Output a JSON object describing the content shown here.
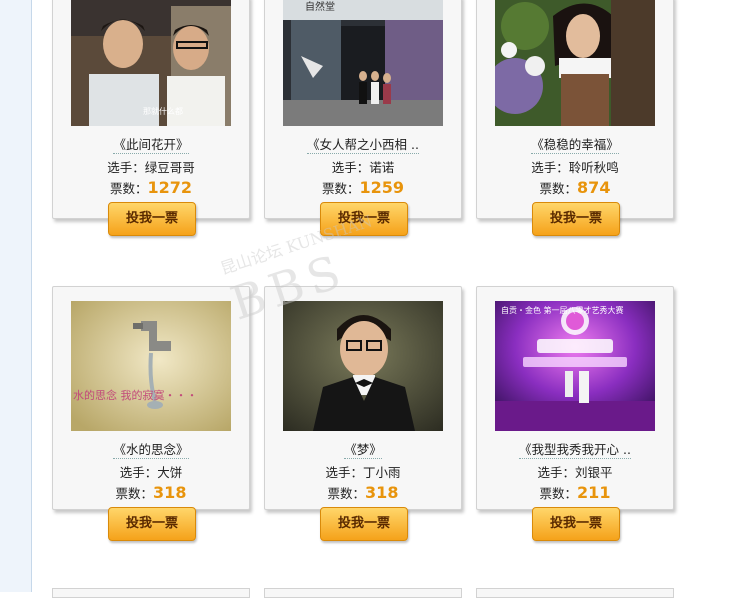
{
  "cards": [
    {
      "title": "《此间花开》",
      "player_label": "选手：",
      "player": "绿豆哥哥",
      "votes_label": "票数：",
      "votes": "1272",
      "button": "投我一票",
      "photo_caption": "那就什么都"
    },
    {
      "title": "《女人帮之小西相 ..",
      "player_label": "选手：",
      "player": "诺诺",
      "votes_label": "票数：",
      "votes": "1259",
      "button": "投我一票",
      "photo_caption": "自然堂"
    },
    {
      "title": "《稳稳的幸福》",
      "player_label": "选手：",
      "player": "聆听秋鸣",
      "votes_label": "票数：",
      "votes": "874",
      "button": "投我一票"
    },
    {
      "title": "《水的思念》",
      "player_label": "选手：",
      "player": "大饼",
      "votes_label": "票数：",
      "votes": "318",
      "button": "投我一票",
      "photo_caption": "水的思念 我的寂寞・・・"
    },
    {
      "title": "《梦》",
      "player_label": "选手：",
      "player": "丁小雨",
      "votes_label": "票数：",
      "votes": "318",
      "button": "投我一票"
    },
    {
      "title": "《我型我秀我开心 ..",
      "player_label": "选手：",
      "player": "刘银平",
      "votes_label": "票数：",
      "votes": "211",
      "button": "投我一票",
      "photo_caption": "自贡・金色 第一届八零才艺秀大赛"
    }
  ],
  "watermark": {
    "big": "BBS",
    "small": "昆山论坛 KUNSHAN"
  }
}
